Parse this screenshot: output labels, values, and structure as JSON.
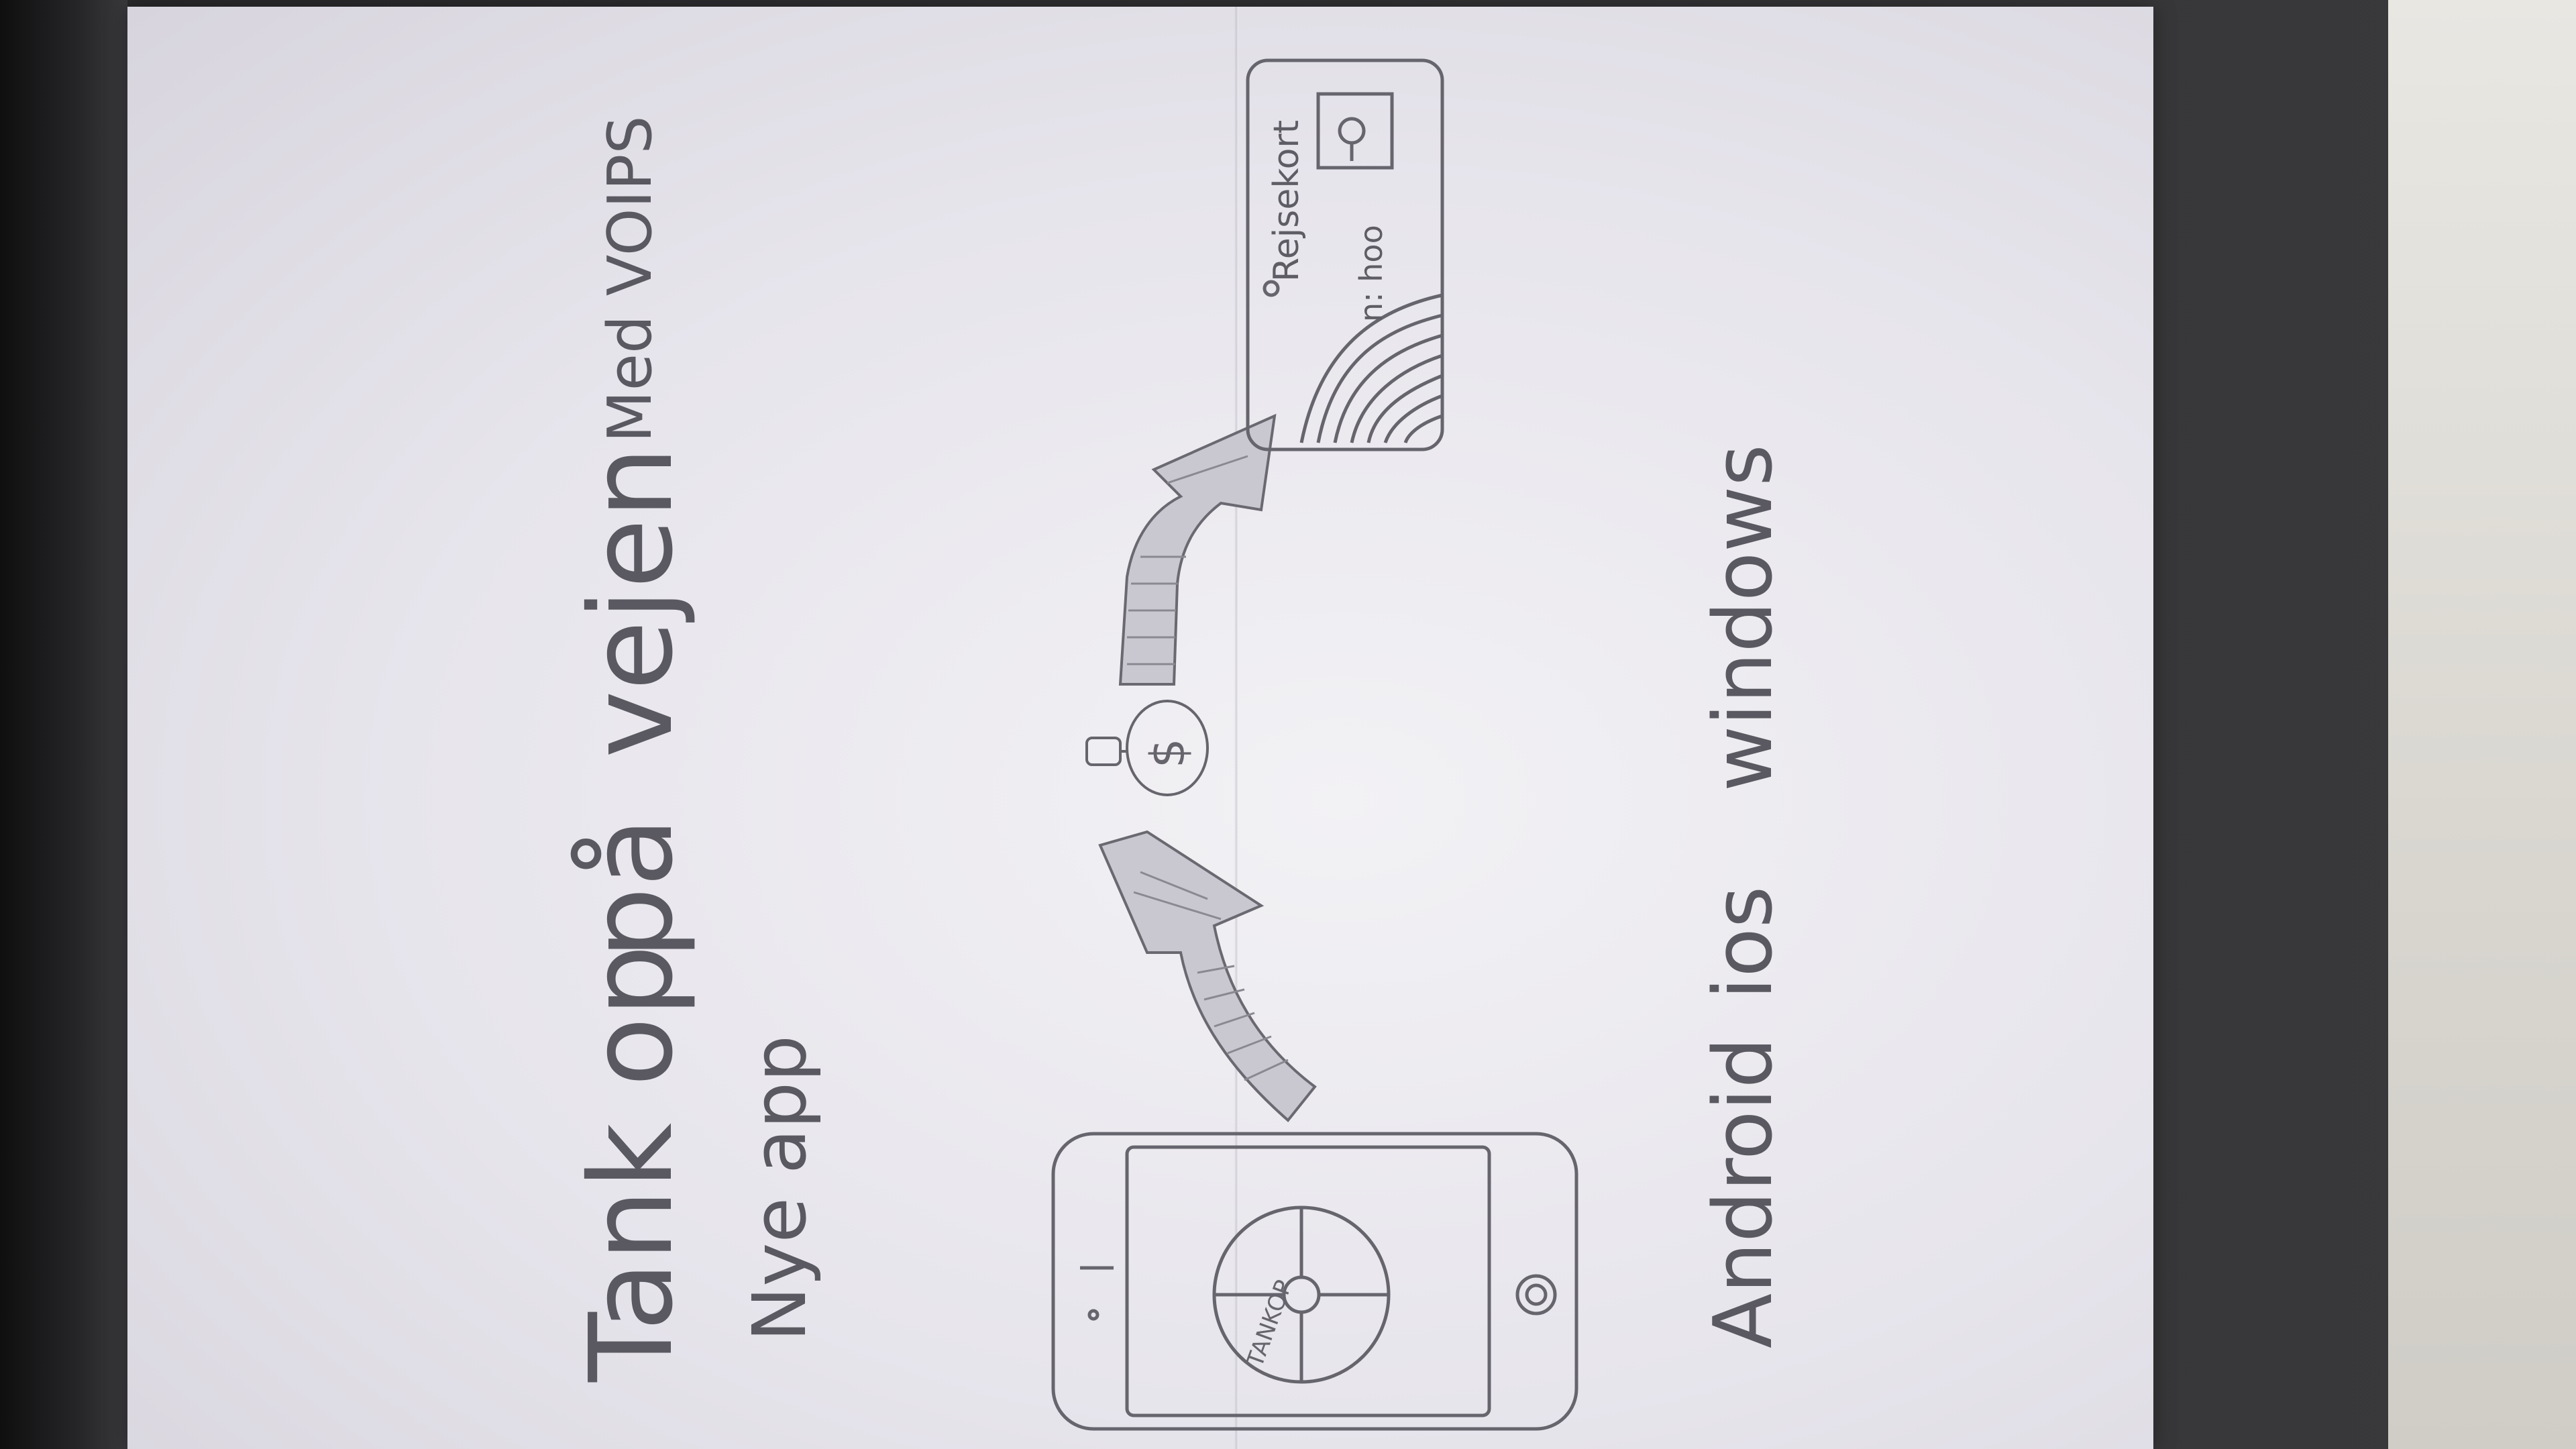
{
  "sketch": {
    "title_line1": "Tank op",
    "title_line2": "på",
    "title_line3": "vejen",
    "subtitle_left": "Nye app",
    "subtitle_right": "Med VOIPS",
    "platforms": [
      "Android",
      "ios",
      "windows"
    ],
    "phone_screen_label": "TANKOP",
    "money_symbol": "$",
    "card_label": "Rejsekort",
    "card_sub": "n: hoo"
  },
  "colors": {
    "paper": "#ecebf0",
    "pencil": "#5a5860",
    "background": "#2b2b2d"
  }
}
